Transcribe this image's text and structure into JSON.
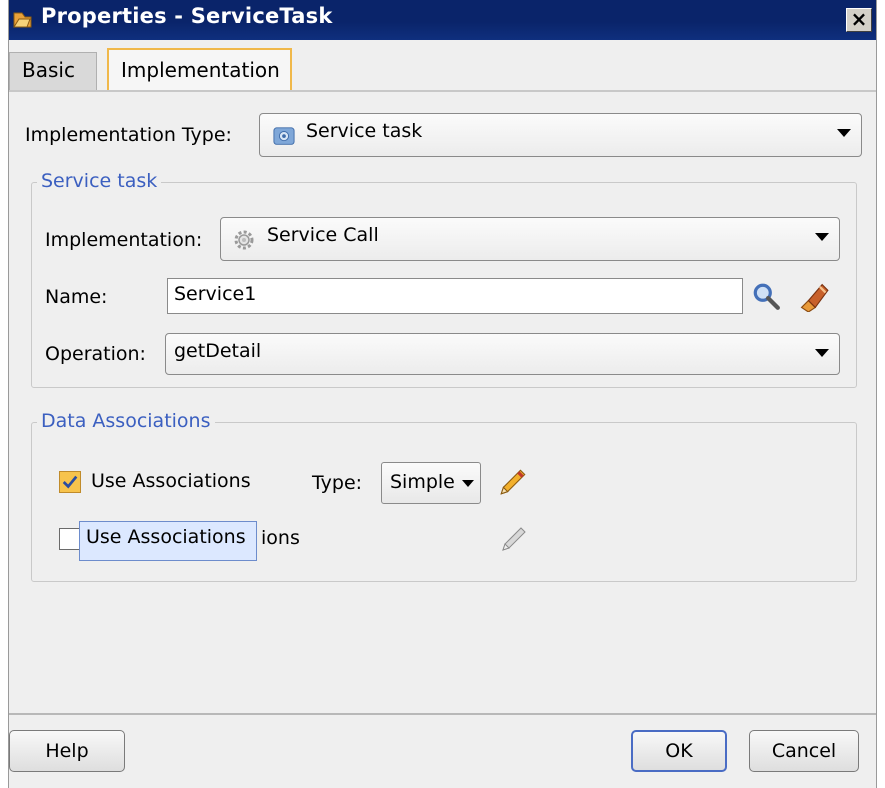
{
  "window": {
    "title": "Properties - ServiceTask",
    "close_glyph": "×"
  },
  "tabs": [
    {
      "label": "Basic",
      "selected": false
    },
    {
      "label": "Implementation",
      "selected": true
    }
  ],
  "implementation_type": {
    "label": "Implementation Type:",
    "value": "Service task",
    "icon": "service-task-icon"
  },
  "service_task_group": {
    "title": "Service task",
    "implementation": {
      "label": "Implementation:",
      "value": "Service Call",
      "icon": "gear-icon"
    },
    "name": {
      "label": "Name:",
      "value": "Service1"
    },
    "operation": {
      "label": "Operation:",
      "value": "getDetail"
    }
  },
  "data_associations_group": {
    "title": "Data Associations",
    "use_input": {
      "label": "Use Associations",
      "checked": true
    },
    "type": {
      "label": "Type:",
      "value": "Simple"
    },
    "use_output": {
      "label_visible": "ions",
      "checked": false
    },
    "tooltip": "Use Associations"
  },
  "buttons": {
    "help": "Help",
    "ok": "OK",
    "cancel": "Cancel"
  },
  "colors": {
    "titlebar": "#0a246a",
    "tab_highlight": "#f0b84a",
    "group_title": "#3b5fc0",
    "default_button": "#4a6cc4"
  }
}
